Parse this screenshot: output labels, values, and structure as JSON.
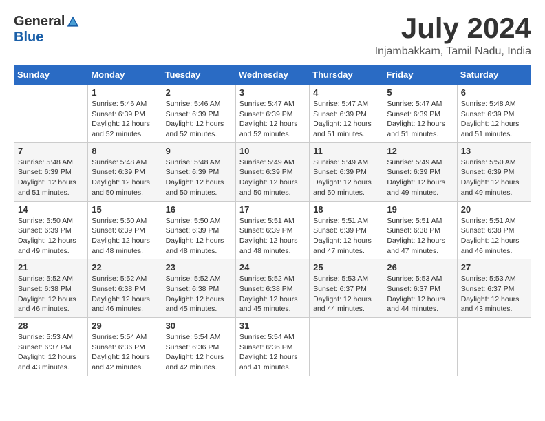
{
  "header": {
    "logo_general": "General",
    "logo_blue": "Blue",
    "month_year": "July 2024",
    "location": "Injambakkam, Tamil Nadu, India"
  },
  "columns": [
    "Sunday",
    "Monday",
    "Tuesday",
    "Wednesday",
    "Thursday",
    "Friday",
    "Saturday"
  ],
  "weeks": [
    [
      {
        "day": "",
        "info": ""
      },
      {
        "day": "1",
        "info": "Sunrise: 5:46 AM\nSunset: 6:39 PM\nDaylight: 12 hours\nand 52 minutes."
      },
      {
        "day": "2",
        "info": "Sunrise: 5:46 AM\nSunset: 6:39 PM\nDaylight: 12 hours\nand 52 minutes."
      },
      {
        "day": "3",
        "info": "Sunrise: 5:47 AM\nSunset: 6:39 PM\nDaylight: 12 hours\nand 52 minutes."
      },
      {
        "day": "4",
        "info": "Sunrise: 5:47 AM\nSunset: 6:39 PM\nDaylight: 12 hours\nand 51 minutes."
      },
      {
        "day": "5",
        "info": "Sunrise: 5:47 AM\nSunset: 6:39 PM\nDaylight: 12 hours\nand 51 minutes."
      },
      {
        "day": "6",
        "info": "Sunrise: 5:48 AM\nSunset: 6:39 PM\nDaylight: 12 hours\nand 51 minutes."
      }
    ],
    [
      {
        "day": "7",
        "info": "Sunrise: 5:48 AM\nSunset: 6:39 PM\nDaylight: 12 hours\nand 51 minutes."
      },
      {
        "day": "8",
        "info": "Sunrise: 5:48 AM\nSunset: 6:39 PM\nDaylight: 12 hours\nand 50 minutes."
      },
      {
        "day": "9",
        "info": "Sunrise: 5:48 AM\nSunset: 6:39 PM\nDaylight: 12 hours\nand 50 minutes."
      },
      {
        "day": "10",
        "info": "Sunrise: 5:49 AM\nSunset: 6:39 PM\nDaylight: 12 hours\nand 50 minutes."
      },
      {
        "day": "11",
        "info": "Sunrise: 5:49 AM\nSunset: 6:39 PM\nDaylight: 12 hours\nand 50 minutes."
      },
      {
        "day": "12",
        "info": "Sunrise: 5:49 AM\nSunset: 6:39 PM\nDaylight: 12 hours\nand 49 minutes."
      },
      {
        "day": "13",
        "info": "Sunrise: 5:50 AM\nSunset: 6:39 PM\nDaylight: 12 hours\nand 49 minutes."
      }
    ],
    [
      {
        "day": "14",
        "info": "Sunrise: 5:50 AM\nSunset: 6:39 PM\nDaylight: 12 hours\nand 49 minutes."
      },
      {
        "day": "15",
        "info": "Sunrise: 5:50 AM\nSunset: 6:39 PM\nDaylight: 12 hours\nand 48 minutes."
      },
      {
        "day": "16",
        "info": "Sunrise: 5:50 AM\nSunset: 6:39 PM\nDaylight: 12 hours\nand 48 minutes."
      },
      {
        "day": "17",
        "info": "Sunrise: 5:51 AM\nSunset: 6:39 PM\nDaylight: 12 hours\nand 48 minutes."
      },
      {
        "day": "18",
        "info": "Sunrise: 5:51 AM\nSunset: 6:39 PM\nDaylight: 12 hours\nand 47 minutes."
      },
      {
        "day": "19",
        "info": "Sunrise: 5:51 AM\nSunset: 6:38 PM\nDaylight: 12 hours\nand 47 minutes."
      },
      {
        "day": "20",
        "info": "Sunrise: 5:51 AM\nSunset: 6:38 PM\nDaylight: 12 hours\nand 46 minutes."
      }
    ],
    [
      {
        "day": "21",
        "info": "Sunrise: 5:52 AM\nSunset: 6:38 PM\nDaylight: 12 hours\nand 46 minutes."
      },
      {
        "day": "22",
        "info": "Sunrise: 5:52 AM\nSunset: 6:38 PM\nDaylight: 12 hours\nand 46 minutes."
      },
      {
        "day": "23",
        "info": "Sunrise: 5:52 AM\nSunset: 6:38 PM\nDaylight: 12 hours\nand 45 minutes."
      },
      {
        "day": "24",
        "info": "Sunrise: 5:52 AM\nSunset: 6:38 PM\nDaylight: 12 hours\nand 45 minutes."
      },
      {
        "day": "25",
        "info": "Sunrise: 5:53 AM\nSunset: 6:37 PM\nDaylight: 12 hours\nand 44 minutes."
      },
      {
        "day": "26",
        "info": "Sunrise: 5:53 AM\nSunset: 6:37 PM\nDaylight: 12 hours\nand 44 minutes."
      },
      {
        "day": "27",
        "info": "Sunrise: 5:53 AM\nSunset: 6:37 PM\nDaylight: 12 hours\nand 43 minutes."
      }
    ],
    [
      {
        "day": "28",
        "info": "Sunrise: 5:53 AM\nSunset: 6:37 PM\nDaylight: 12 hours\nand 43 minutes."
      },
      {
        "day": "29",
        "info": "Sunrise: 5:54 AM\nSunset: 6:36 PM\nDaylight: 12 hours\nand 42 minutes."
      },
      {
        "day": "30",
        "info": "Sunrise: 5:54 AM\nSunset: 6:36 PM\nDaylight: 12 hours\nand 42 minutes."
      },
      {
        "day": "31",
        "info": "Sunrise: 5:54 AM\nSunset: 6:36 PM\nDaylight: 12 hours\nand 41 minutes."
      },
      {
        "day": "",
        "info": ""
      },
      {
        "day": "",
        "info": ""
      },
      {
        "day": "",
        "info": ""
      }
    ]
  ]
}
